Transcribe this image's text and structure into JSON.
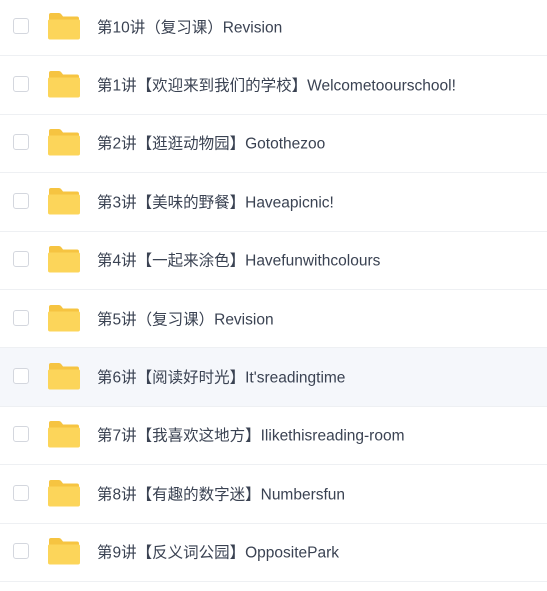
{
  "icon": "folder-icon",
  "colors": {
    "folder_back": "#F6C441",
    "folder_front": "#FCD55A",
    "text": "#3A4252",
    "selected_row": "#F5F7FB",
    "divider": "#EEF0F3"
  },
  "items": [
    {
      "label": "第10讲（复习课）Revision",
      "selected": false
    },
    {
      "label": "第1讲【欢迎来到我们的学校】Welcometoourschool!",
      "selected": false
    },
    {
      "label": "第2讲【逛逛动物园】Gotothezoo",
      "selected": false
    },
    {
      "label": "第3讲【美味的野餐】Haveapicnic!",
      "selected": false
    },
    {
      "label": "第4讲【一起来涂色】Havefunwithcolours",
      "selected": false
    },
    {
      "label": "第5讲（复习课）Revision",
      "selected": false
    },
    {
      "label": "第6讲【阅读好时光】It'sreadingtime",
      "selected": true
    },
    {
      "label": "第7讲【我喜欢这地方】Ilikethisreading-room",
      "selected": false
    },
    {
      "label": "第8讲【有趣的数字迷】Numbersfun",
      "selected": false
    },
    {
      "label": "第9讲【反义词公园】OppositePark",
      "selected": false
    }
  ]
}
